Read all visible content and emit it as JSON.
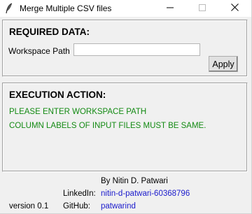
{
  "window": {
    "title": "Merge Multiple CSV files"
  },
  "required": {
    "heading": "REQUIRED DATA:",
    "workspace_label": "Workspace Path",
    "workspace_value": "",
    "apply_label": "Apply"
  },
  "execution": {
    "heading": "EXECUTION ACTION:",
    "messages": [
      "PLEASE ENTER WORKSPACE PATH",
      "COLUMN LABELS OF INPUT FILES MUST BE SAME."
    ],
    "message_color": "#138a13"
  },
  "footer": {
    "author": "By Nitin D. Patwari",
    "linkedin_label": "LinkedIn:",
    "linkedin_value": "nitin-d-patwari-60368796",
    "github_label": "GitHub:",
    "github_value": "patwarind",
    "version": "version 0.1",
    "link_color": "#1a1acc"
  },
  "icons": [
    "feather-icon",
    "minimize-icon",
    "maximize-icon",
    "close-icon"
  ]
}
